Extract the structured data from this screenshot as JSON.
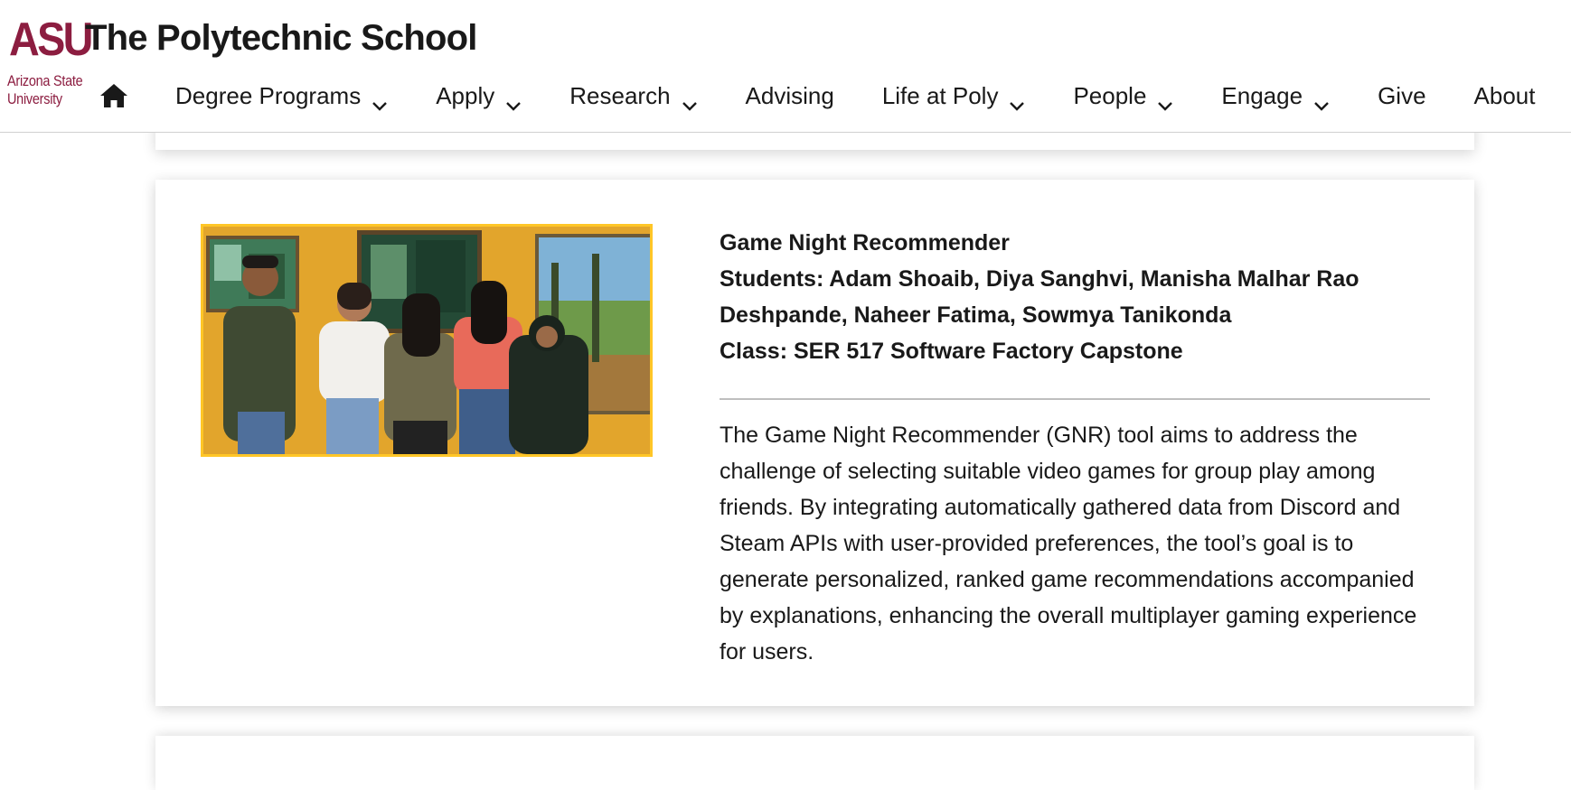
{
  "header": {
    "logo": {
      "mark": "ASU",
      "line1": "Arizona State",
      "line2": "University"
    },
    "title": "The Polytechnic School",
    "nav": [
      {
        "label": "Degree Programs",
        "dropdown": true
      },
      {
        "label": "Apply",
        "dropdown": true
      },
      {
        "label": "Research",
        "dropdown": true
      },
      {
        "label": "Advising",
        "dropdown": false
      },
      {
        "label": "Life at Poly",
        "dropdown": true
      },
      {
        "label": "People",
        "dropdown": true
      },
      {
        "label": "Engage",
        "dropdown": true
      },
      {
        "label": "Give",
        "dropdown": false
      },
      {
        "label": "About",
        "dropdown": false
      }
    ],
    "icons": {
      "home": "home-icon",
      "dropdown": "chevron-down-icon"
    }
  },
  "project": {
    "photo_description_icon": "team-photo",
    "title": "Game Night Recommender",
    "students": "Students: Adam Shoaib, Diya Sanghvi, Manisha Malhar Rao Deshpande, Naheer Fatima, Sowmya Tanikonda",
    "class": "Class: SER 517 Software Factory Capstone",
    "description": "The Game Night Recommender (GNR) tool aims to address the challenge of selecting suitable video games for group play among friends. By integrating automatically gathered data from Discord and Steam APIs with user-provided preferences, the tool’s goal is to generate personalized, ranked game recommendations accompanied by explanations, enhancing the overall multiplayer gaming experience for users."
  },
  "colors": {
    "maroon": "#8c1d40",
    "gold": "#ffc627",
    "text": "#191919"
  }
}
